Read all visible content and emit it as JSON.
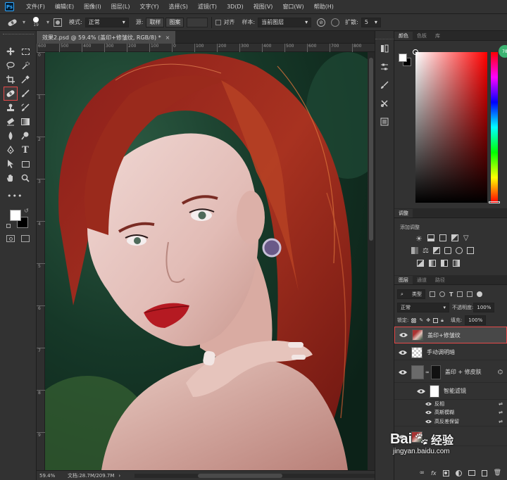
{
  "menubar": {
    "app_logo": "Ps",
    "items": [
      "文件(F)",
      "编辑(E)",
      "图像(I)",
      "图层(L)",
      "文字(Y)",
      "选择(S)",
      "滤镜(T)",
      "3D(D)",
      "视图(V)",
      "窗口(W)",
      "帮助(H)"
    ]
  },
  "options": {
    "brush_size": "19",
    "mode_label": "模式:",
    "mode_value": "正常",
    "source_label": "源:",
    "source_sample": "取样",
    "source_pattern": "图案",
    "aligned_label": "对齐",
    "sample_label": "样本:",
    "sample_value": "当前图层",
    "diffusion_label": "扩散:",
    "diffusion_value": "5"
  },
  "document": {
    "tab_title": "效果2.psd @ 59.4% (盖印+修皱纹, RGB/8) *",
    "ruler_top_ticks": [
      "600",
      "500",
      "400",
      "300",
      "200",
      "100",
      "0",
      "100",
      "200",
      "300",
      "400",
      "500",
      "600",
      "700",
      "800"
    ],
    "ruler_left_ticks": [
      "0",
      "1",
      "2",
      "3",
      "4",
      "5",
      "6",
      "7",
      "8",
      "9"
    ]
  },
  "status": {
    "zoom": "59.4%",
    "doc_info": "文档:28.7M/209.7M"
  },
  "color_panel": {
    "tabs": [
      "颜色",
      "色板",
      "库"
    ],
    "badge": "78"
  },
  "adjust_panel": {
    "tabs": [
      "调整"
    ],
    "add_label": "添加调整"
  },
  "layers_panel": {
    "tabs": [
      "图层",
      "通道",
      "路径"
    ],
    "filter_kind": "类型",
    "blend_mode": "正常",
    "opacity_label": "不透明度:",
    "opacity_value": "100%",
    "lock_label": "锁定:",
    "fill_label": "填充:",
    "fill_value": "100%",
    "layers": [
      {
        "name": "盖印+修皱纹"
      },
      {
        "name": "手动调明暗"
      },
      {
        "name": "盖印 + 修皮肤"
      },
      {
        "name": "智能滤镜"
      },
      {
        "name": "反相"
      },
      {
        "name": "高斯模糊"
      },
      {
        "name": "高反差保留"
      }
    ]
  },
  "watermark": {
    "brand": "Bai",
    "brand_suffix": "经验",
    "url": "jingyan.baidu.com"
  },
  "colors": {
    "accent": "#31a8ff",
    "panel_bg": "#323232",
    "selected_layer_border": "#e64a4a",
    "fg_swatch": "#ffffff",
    "bg_swatch": "#000000"
  }
}
